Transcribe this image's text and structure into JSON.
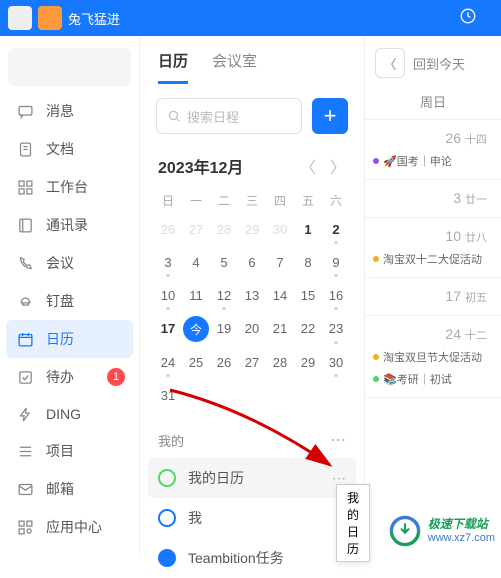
{
  "titlebar": {
    "name": "兔飞猛进"
  },
  "sidebar": {
    "items": [
      {
        "label": "消息"
      },
      {
        "label": "文档"
      },
      {
        "label": "工作台"
      },
      {
        "label": "通讯录"
      },
      {
        "label": "会议"
      },
      {
        "label": "钉盘"
      },
      {
        "label": "日历"
      },
      {
        "label": "待办",
        "badge": "1"
      },
      {
        "label": "DING"
      },
      {
        "label": "项目"
      },
      {
        "label": "邮箱"
      },
      {
        "label": "应用中心"
      }
    ]
  },
  "tabs": {
    "calendar": "日历",
    "meeting": "会议室"
  },
  "search": {
    "placeholder": "搜索日程"
  },
  "month": {
    "label": "2023年12月"
  },
  "weekdays": [
    "日",
    "一",
    "二",
    "三",
    "四",
    "五",
    "六"
  ],
  "calendar_rows": [
    [
      {
        "d": "26",
        "cls": "other"
      },
      {
        "d": "27",
        "cls": "other"
      },
      {
        "d": "28",
        "cls": "other"
      },
      {
        "d": "29",
        "cls": "other"
      },
      {
        "d": "30",
        "cls": "other"
      },
      {
        "d": "1",
        "cls": "active"
      },
      {
        "d": "2",
        "cls": "active dot"
      }
    ],
    [
      {
        "d": "3",
        "cls": "dot"
      },
      {
        "d": "4",
        "cls": ""
      },
      {
        "d": "5",
        "cls": ""
      },
      {
        "d": "6",
        "cls": ""
      },
      {
        "d": "7",
        "cls": ""
      },
      {
        "d": "8",
        "cls": ""
      },
      {
        "d": "9",
        "cls": "dot"
      }
    ],
    [
      {
        "d": "10",
        "cls": "dot"
      },
      {
        "d": "11",
        "cls": ""
      },
      {
        "d": "12",
        "cls": "dot"
      },
      {
        "d": "13",
        "cls": ""
      },
      {
        "d": "14",
        "cls": ""
      },
      {
        "d": "15",
        "cls": ""
      },
      {
        "d": "16",
        "cls": "dot"
      }
    ],
    [
      {
        "d": "17",
        "cls": "active"
      },
      {
        "d": "今",
        "cls": "today"
      },
      {
        "d": "19",
        "cls": ""
      },
      {
        "d": "20",
        "cls": ""
      },
      {
        "d": "21",
        "cls": ""
      },
      {
        "d": "22",
        "cls": ""
      },
      {
        "d": "23",
        "cls": "dot"
      }
    ],
    [
      {
        "d": "24",
        "cls": "dot"
      },
      {
        "d": "25",
        "cls": ""
      },
      {
        "d": "26",
        "cls": ""
      },
      {
        "d": "27",
        "cls": ""
      },
      {
        "d": "28",
        "cls": ""
      },
      {
        "d": "29",
        "cls": ""
      },
      {
        "d": "30",
        "cls": "dot"
      }
    ],
    [
      {
        "d": "31",
        "cls": ""
      },
      {
        "d": "",
        "cls": ""
      },
      {
        "d": "",
        "cls": ""
      },
      {
        "d": "",
        "cls": ""
      },
      {
        "d": "",
        "cls": ""
      },
      {
        "d": "",
        "cls": ""
      },
      {
        "d": "",
        "cls": ""
      }
    ]
  ],
  "my_section": {
    "label": "我的"
  },
  "my_items": [
    {
      "label": "我的日历",
      "hover": true
    },
    {
      "label": "我"
    },
    {
      "label": "Teambition任务"
    }
  ],
  "tooltip": "我的日历",
  "schedule": {
    "today_btn": "回到今天",
    "day_head": "周日",
    "days": [
      {
        "num": "26",
        "lunar": "十四",
        "events": [
          {
            "dot": "purple",
            "text": "🚀国考｜申论"
          }
        ]
      },
      {
        "num": "3",
        "lunar": "廿一",
        "events": []
      },
      {
        "num": "10",
        "lunar": "廿八",
        "events": [
          {
            "dot": "orange",
            "text": "淘宝双十二大促活动"
          }
        ]
      },
      {
        "num": "17",
        "lunar": "初五",
        "events": []
      },
      {
        "num": "24",
        "lunar": "十二",
        "events": [
          {
            "dot": "orange",
            "text": "淘宝双旦节大促活动"
          },
          {
            "dot": "",
            "text": "📚考研｜初试"
          }
        ]
      }
    ]
  },
  "watermark": {
    "line1": "极速下载站",
    "line2": "www.xz7.com"
  }
}
